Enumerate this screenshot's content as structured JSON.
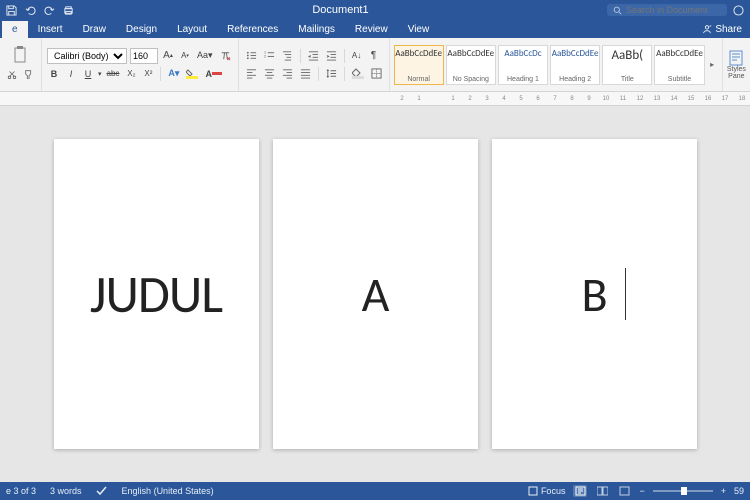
{
  "titlebar": {
    "title": "Document1",
    "search_placeholder": "Search in Document"
  },
  "tabs": {
    "items": [
      "e",
      "Insert",
      "Draw",
      "Design",
      "Layout",
      "References",
      "Mailings",
      "Review",
      "View"
    ],
    "share": "Share"
  },
  "ribbon": {
    "font_name": "Calibri (Body)",
    "font_size": "160",
    "btn_bold": "B",
    "btn_italic": "I",
    "btn_underline": "U",
    "btn_strike": "abc",
    "btn_sub": "X₂",
    "btn_sup": "X²",
    "styles": [
      {
        "preview": "AaBbCcDdEe",
        "label": "Normal",
        "sel": true,
        "cls": ""
      },
      {
        "preview": "AaBbCcDdEe",
        "label": "No Spacing",
        "sel": false,
        "cls": ""
      },
      {
        "preview": "AaBbCcDc",
        "label": "Heading 1",
        "sel": false,
        "cls": "h1"
      },
      {
        "preview": "AaBbCcDdEe",
        "label": "Heading 2",
        "sel": false,
        "cls": "h2"
      },
      {
        "preview": "AaBb(",
        "label": "Title",
        "sel": false,
        "cls": "title"
      },
      {
        "preview": "AaBbCcDdEe",
        "label": "Subtitle",
        "sel": false,
        "cls": ""
      }
    ],
    "styles_pane": "Styles Pane"
  },
  "ruler": [
    "2",
    "1",
    "",
    "1",
    "2",
    "3",
    "4",
    "5",
    "6",
    "7",
    "8",
    "9",
    "10",
    "11",
    "12",
    "13",
    "14",
    "15",
    "16",
    "17",
    "18"
  ],
  "pages": [
    {
      "text": "JUDUL"
    },
    {
      "text": "A"
    },
    {
      "text": "B"
    }
  ],
  "status": {
    "page": "e 3 of 3",
    "words": "3 words",
    "language": "English (United States)",
    "focus": "Focus",
    "zoom": "59"
  }
}
